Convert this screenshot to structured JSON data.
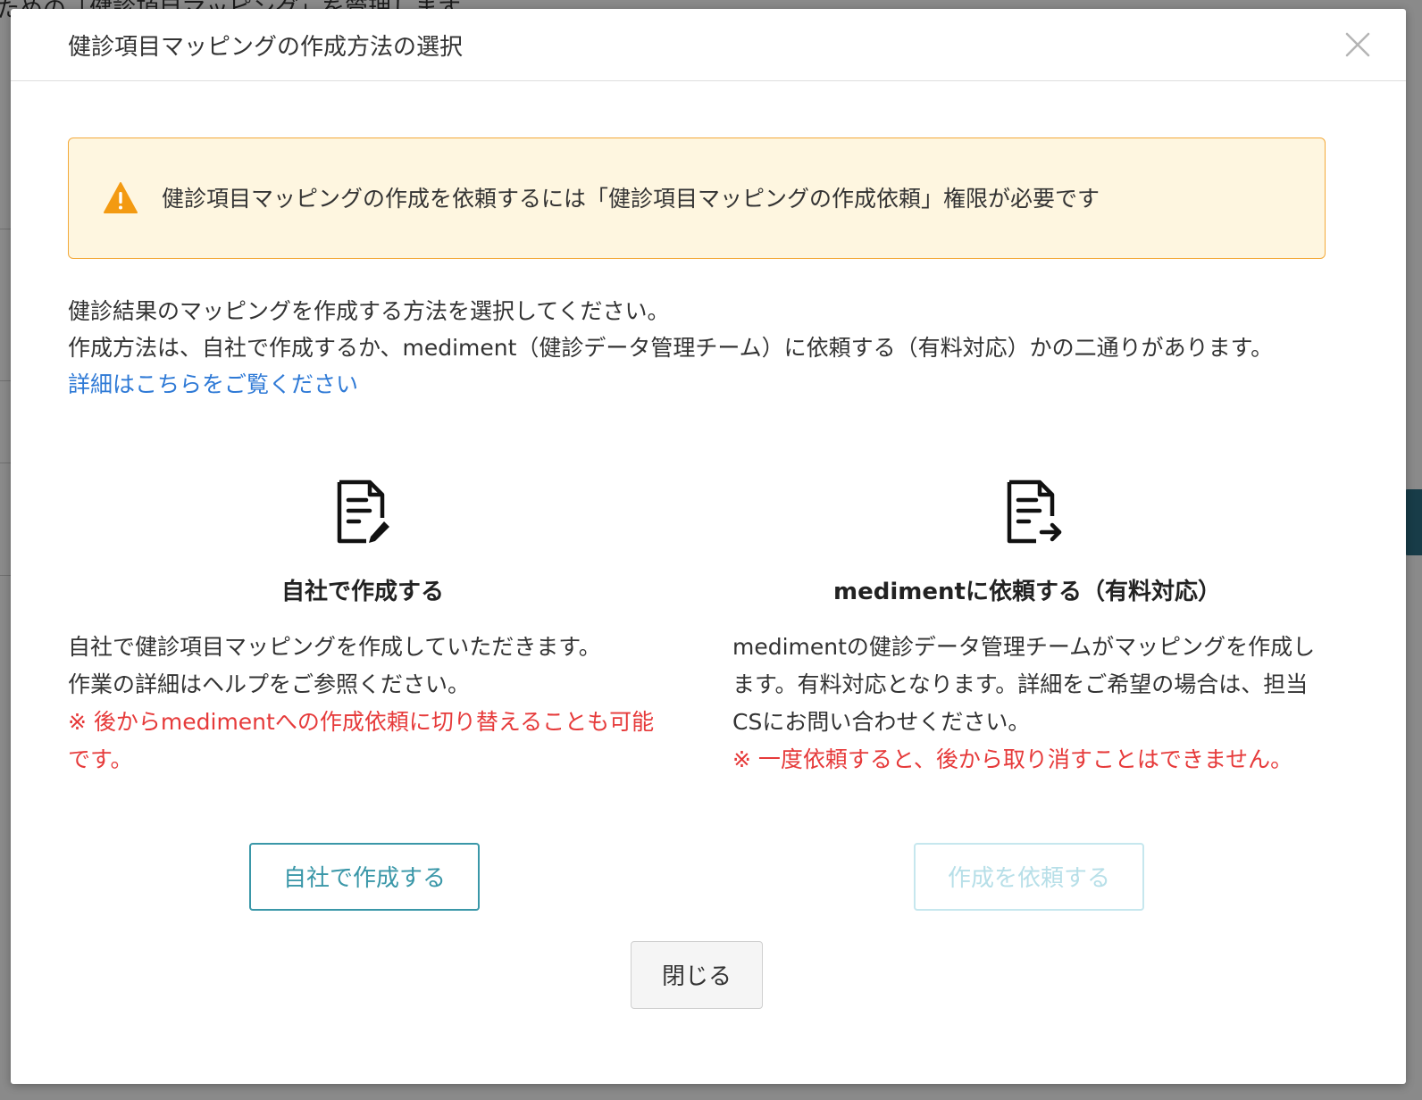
{
  "background": {
    "text": "ための「健診項目マッピング」を管理します"
  },
  "modal": {
    "title": "健診項目マッピングの作成方法の選択",
    "alert": "健診項目マッピングの作成を依頼するには「健診項目マッピングの作成依頼」権限が必要です",
    "intro": [
      "健診結果のマッピングを作成する方法を選択してください。",
      "作成方法は、自社で作成するか、mediment（健診データ管理チーム）に依頼する（有料対応）かの二通りがあります。"
    ],
    "detail_link": "詳細はこちらをご覧ください",
    "options": [
      {
        "title": "自社で作成する",
        "desc": [
          "自社で健診項目マッピングを作成していただきます。",
          "作業の詳細はヘルプをご参照ください。"
        ],
        "note": "※ 後からmedimentへの作成依頼に切り替えることも可能です。",
        "button": "自社で作成する"
      },
      {
        "title": "medimentに依頼する（有料対応）",
        "desc": [
          "medimentの健診データ管理チームがマッピングを作成します。有料対応となります。詳細をご希望の場合は、担当CSにお問い合わせください。"
        ],
        "note": "※ 一度依頼すると、後から取り消すことはできません。",
        "button": "作成を依頼する"
      }
    ],
    "close_button": "閉じる"
  },
  "colors": {
    "accent": "#3a97a8",
    "accent_disabled": "#b7dfe8",
    "warning_border": "#f3a93a",
    "warning_bg": "#fef6e0",
    "note_red": "#e63a3a",
    "link": "#2f7ad6"
  }
}
